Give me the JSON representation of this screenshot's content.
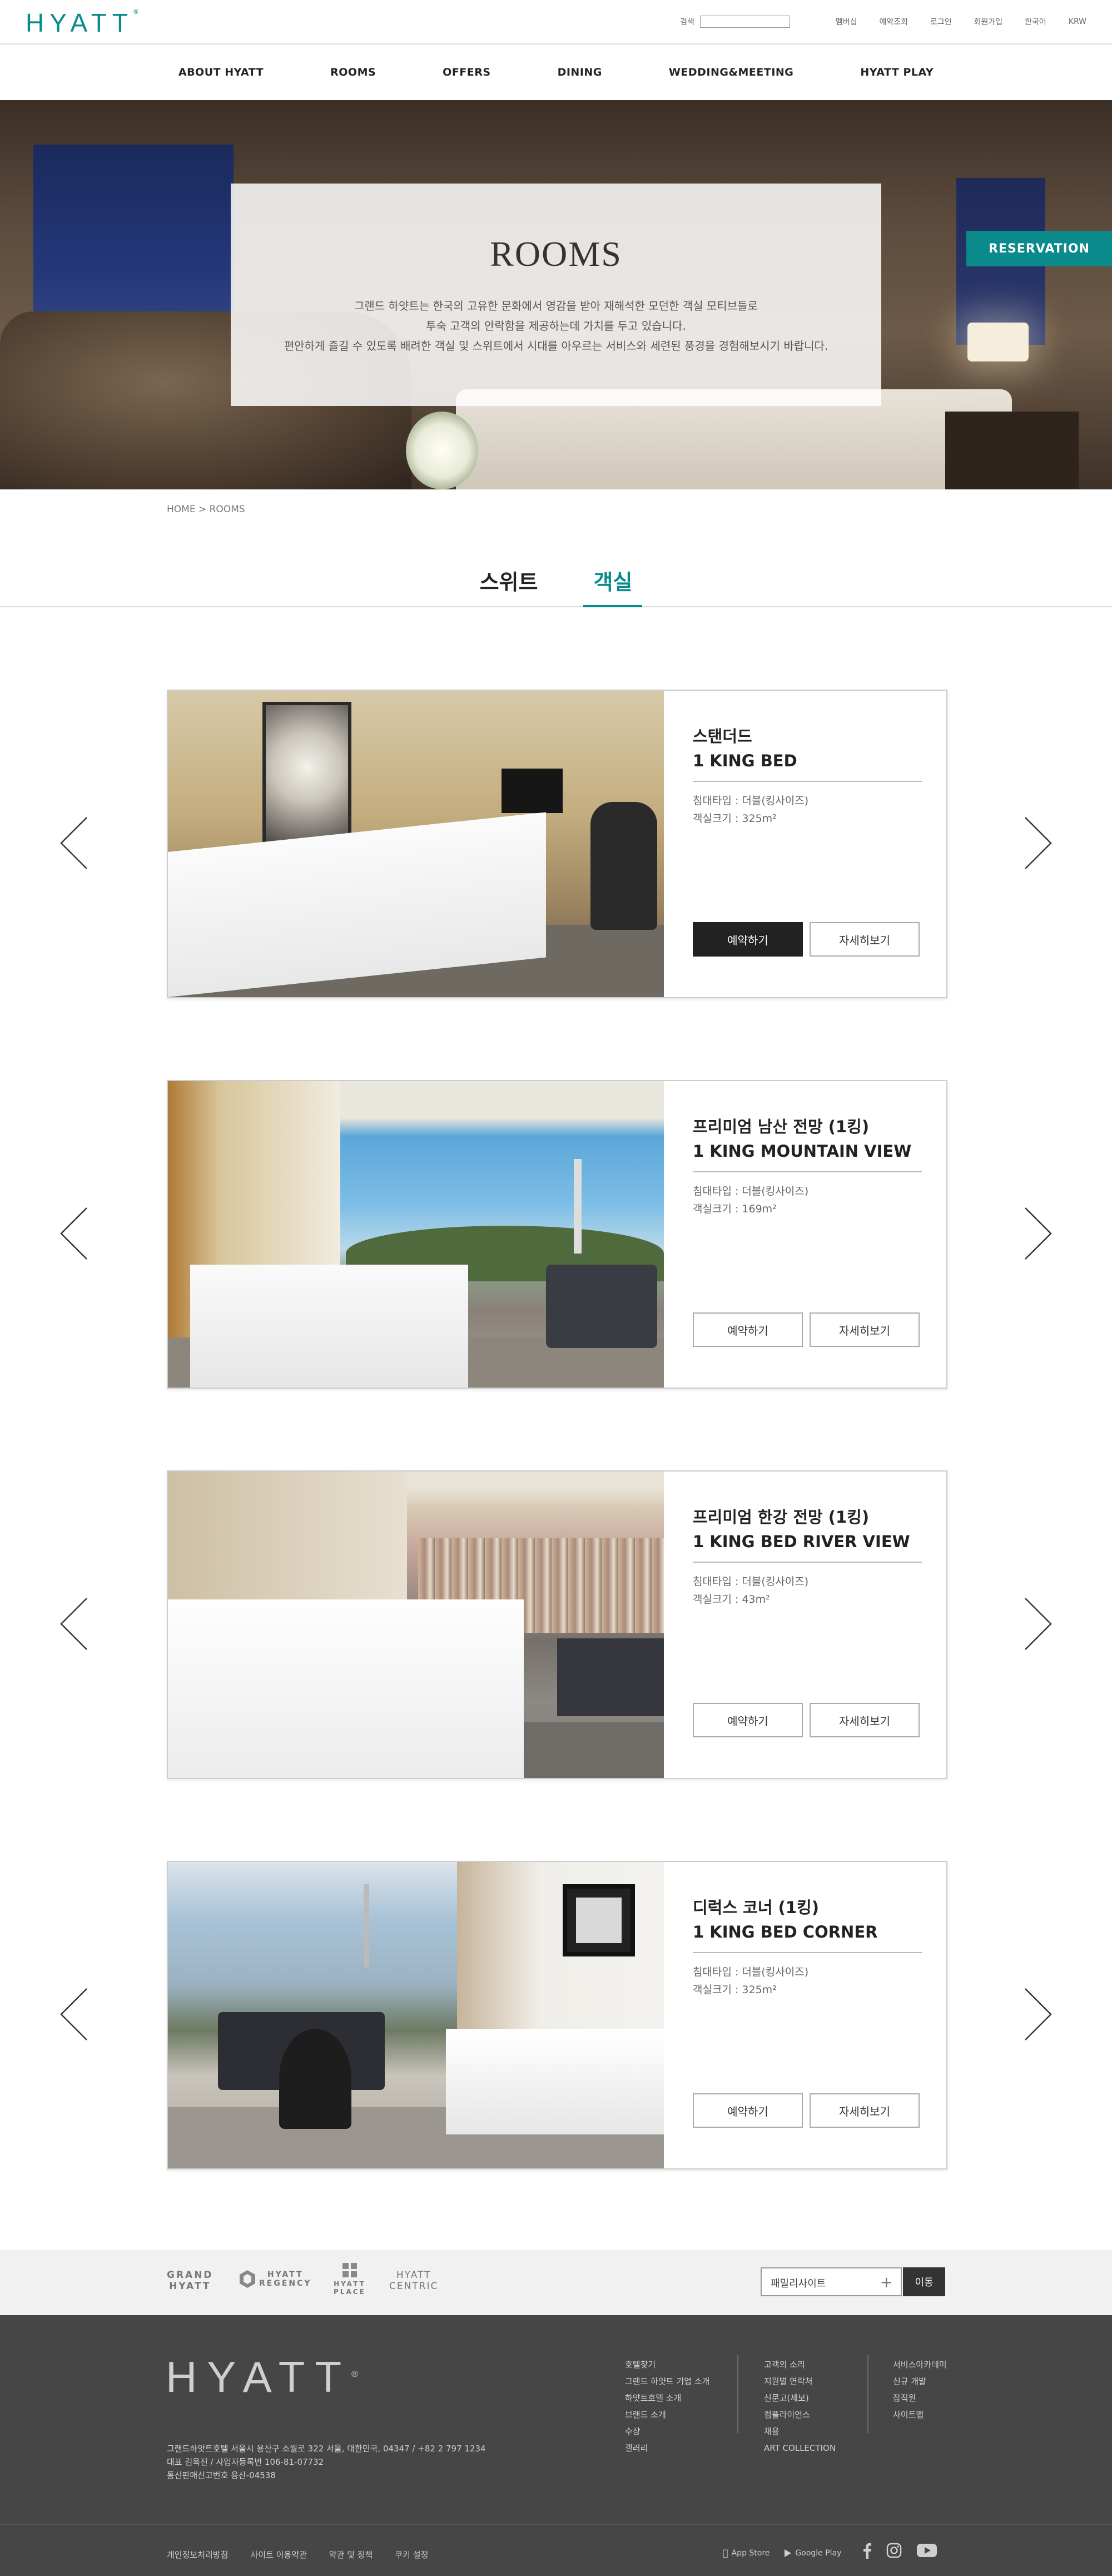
{
  "header": {
    "logo": "HYATT",
    "logo_mark": "®",
    "search_label": "검색",
    "utility_links": [
      "멤버십",
      "예약조회",
      "로그인",
      "회원가입",
      "한국어",
      "KRW"
    ]
  },
  "nav": {
    "items": [
      "ABOUT HYATT",
      "ROOMS",
      "OFFERS",
      "DINING",
      "WEDDING&MEETING",
      "HYATT PLAY"
    ]
  },
  "hero": {
    "title": "ROOMS",
    "desc_line1": "그랜드 하얏트는 한국의 고유한 문화에서 영감을 받아 재해석한 모던한 객실 모티브들로",
    "desc_line2": "투숙 고객의 안락함을 제공하는데 가치를 두고 있습니다.",
    "desc_line3": "편안하게 즐길 수 있도록 배려한 객실 및 스위트에서 시대를 아우르는 서비스와 세련된 풍경을 경험해보시기 바랍니다.",
    "reservation_label": "RESERVATION"
  },
  "breadcrumb": "HOME > ROOMS",
  "tabs": [
    {
      "label": "스위트",
      "active": false
    },
    {
      "label": "객실",
      "active": true
    }
  ],
  "rooms": [
    {
      "name_ko": "스탠더드",
      "name_en": "1 KING BED",
      "bed_type": "침대타입 : 더블(킹사이즈)",
      "size": "객실크기 : 325m²",
      "book_label": "예약하기",
      "detail_label": "자세히보기"
    },
    {
      "name_ko": "프리미엄 남산 전망 (1킹)",
      "name_en": "1 KING MOUNTAIN VIEW",
      "bed_type": "침대타입 : 더블(킹사이즈)",
      "size": "객실크기 : 169m²",
      "book_label": "예약하기",
      "detail_label": "자세히보기"
    },
    {
      "name_ko": "프리미엄 한강 전망 (1킹)",
      "name_en": "1 KING BED RIVER VIEW",
      "bed_type": "침대타입 : 더블(킹사이즈)",
      "size": "객실크기 : 43m²",
      "book_label": "예약하기",
      "detail_label": "자세히보기"
    },
    {
      "name_ko": "디럭스 코너 (1킹)",
      "name_en": "1 KING BED CORNER",
      "bed_type": "침대타입 : 더블(킹사이즈)",
      "size": "객실크기 : 325m²",
      "book_label": "예약하기",
      "detail_label": "자세히보기"
    }
  ],
  "brands": {
    "grand_hyatt_1": "GRAND",
    "grand_hyatt_2": "HYATT",
    "regency_1": "HYATT",
    "regency_2": "REGENCY",
    "place_1": "HYATT",
    "place_2": "PLACE",
    "centric_1": "HYATT",
    "centric_2": "CENTRIC",
    "family_site_label": "패밀리사이트",
    "go_label": "이동"
  },
  "footer": {
    "logo": "HYATT",
    "address_line1": "그랜드하얏트호텔 서울시 용산구 소월로 322 서울, 대한민국, 04347 / +82 2 797 1234",
    "address_line2": "대표 김옥진 / 사업자등록번 106-81-07732",
    "address_line3": "통신판매신고번호 용산-04538",
    "col1": [
      "호텔찾기",
      "그랜드 하얏트 기업 소개",
      "하얏트호텔 소개",
      "브랜드 소개",
      "수상",
      "갤러리"
    ],
    "col2": [
      "고객의 소리",
      "지원별 연락처",
      "신문고(제보)",
      "컴플라이언스",
      "채용",
      "ART COLLECTION"
    ],
    "col3": [
      "서비스아카데미",
      "신규 개발",
      "잡직원",
      "사이트맵"
    ],
    "bottom_links": [
      "개인정보처리방침",
      "사이트 이용약관",
      "약관 및 정책",
      "쿠키 설정"
    ],
    "app_store": "App Store",
    "google_play": "Google Play"
  }
}
